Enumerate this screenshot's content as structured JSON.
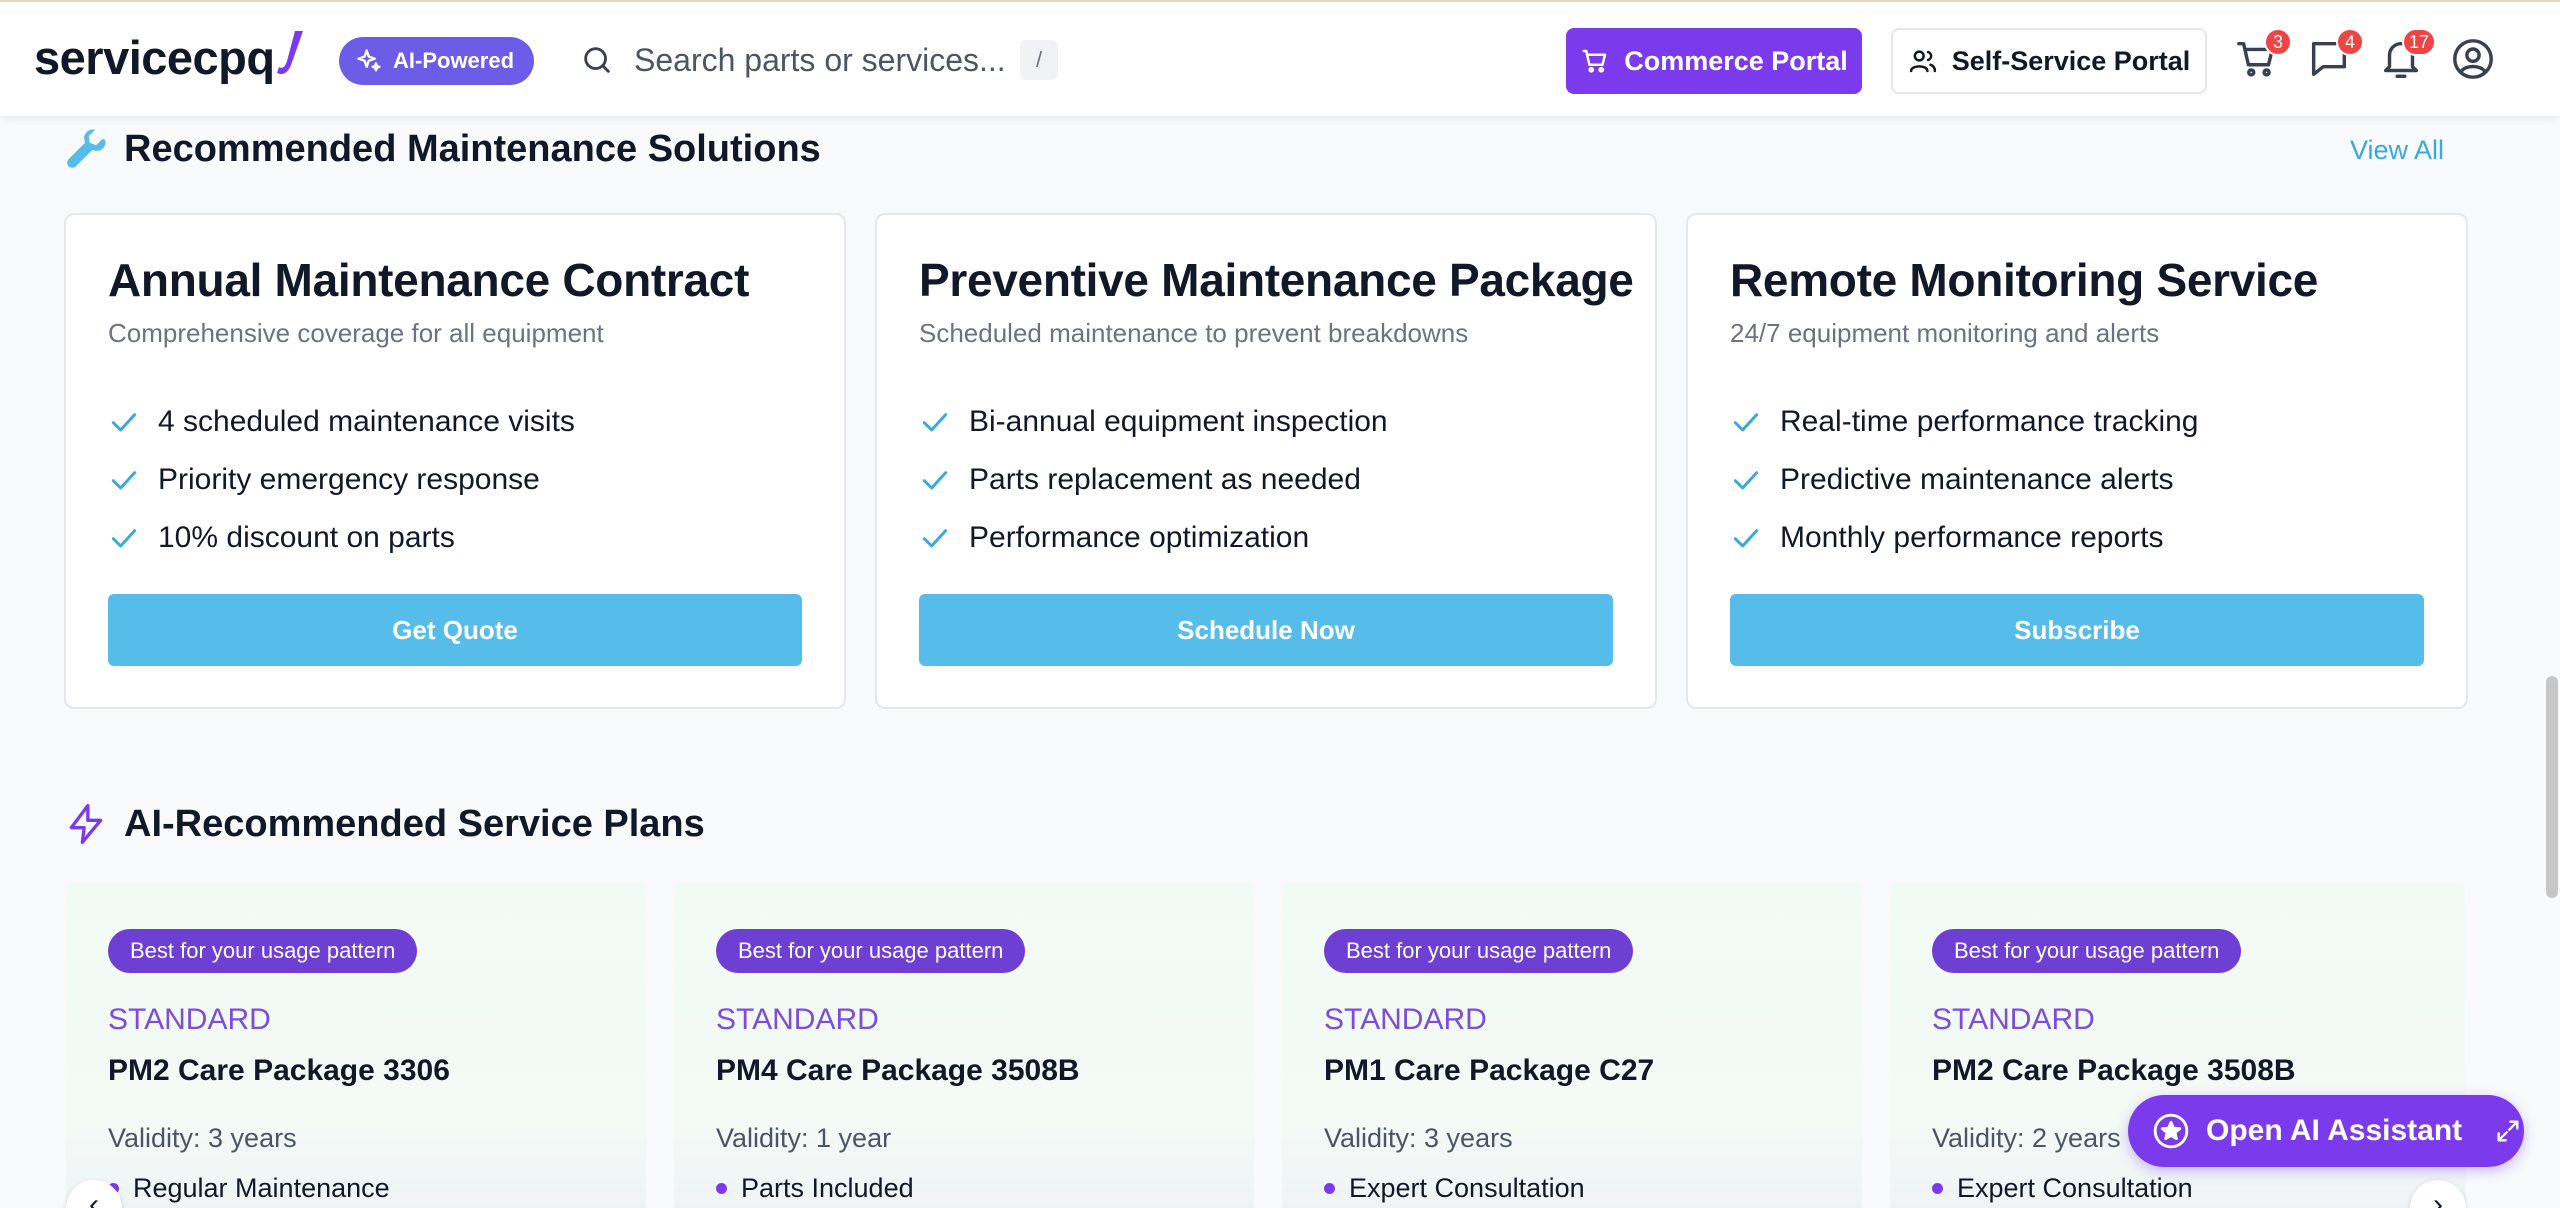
{
  "header": {
    "logo_text": "servicecpq",
    "ai_badge": "AI-Powered",
    "search_placeholder": "Search parts or services...",
    "search_shortcut": "/",
    "commerce_portal": "Commerce Portal",
    "self_service_portal": "Self-Service Portal",
    "cart_count": "3",
    "messages_count": "4",
    "notifications_count": "17"
  },
  "maintenance": {
    "section_title": "Recommended Maintenance Solutions",
    "view_all": "View All",
    "cards": [
      {
        "title": "Annual Maintenance Contract",
        "subtitle": "Comprehensive coverage for all equipment",
        "features": [
          "4 scheduled maintenance visits",
          "Priority emergency response",
          "10% discount on parts"
        ],
        "button": "Get Quote"
      },
      {
        "title": "Preventive Maintenance Package",
        "subtitle": "Scheduled maintenance to prevent breakdowns",
        "features": [
          "Bi-annual equipment inspection",
          "Parts replacement as needed",
          "Performance optimization"
        ],
        "button": "Schedule Now"
      },
      {
        "title": "Remote Monitoring Service",
        "subtitle": "24/7 equipment monitoring and alerts",
        "features": [
          "Real-time performance tracking",
          "Predictive maintenance alerts",
          "Monthly performance reports"
        ],
        "button": "Subscribe"
      }
    ]
  },
  "service_plans": {
    "section_title": "AI-Recommended Service Plans",
    "plans": [
      {
        "pill": "Best for your usage pattern",
        "tier": "STANDARD",
        "name": "PM2 Care Package 3306",
        "validity": "Validity: 3 years",
        "perk": "Regular Maintenance"
      },
      {
        "pill": "Best for your usage pattern",
        "tier": "STANDARD",
        "name": "PM4 Care Package 3508B",
        "validity": "Validity: 1 year",
        "perk": "Parts Included"
      },
      {
        "pill": "Best for your usage pattern",
        "tier": "STANDARD",
        "name": "PM1 Care Package C27",
        "validity": "Validity: 3 years",
        "perk": "Expert Consultation"
      },
      {
        "pill": "Best for your usage pattern",
        "tier": "STANDARD",
        "name": "PM2 Care Package 3508B",
        "validity": "Validity: 2 years",
        "perk": "Expert Consultation"
      }
    ]
  },
  "assistant": {
    "label": "Open AI Assistant"
  },
  "colors": {
    "brand_purple": "#7c3aed",
    "accent_blue": "#56bdeb",
    "badge_red": "#ef4444"
  }
}
